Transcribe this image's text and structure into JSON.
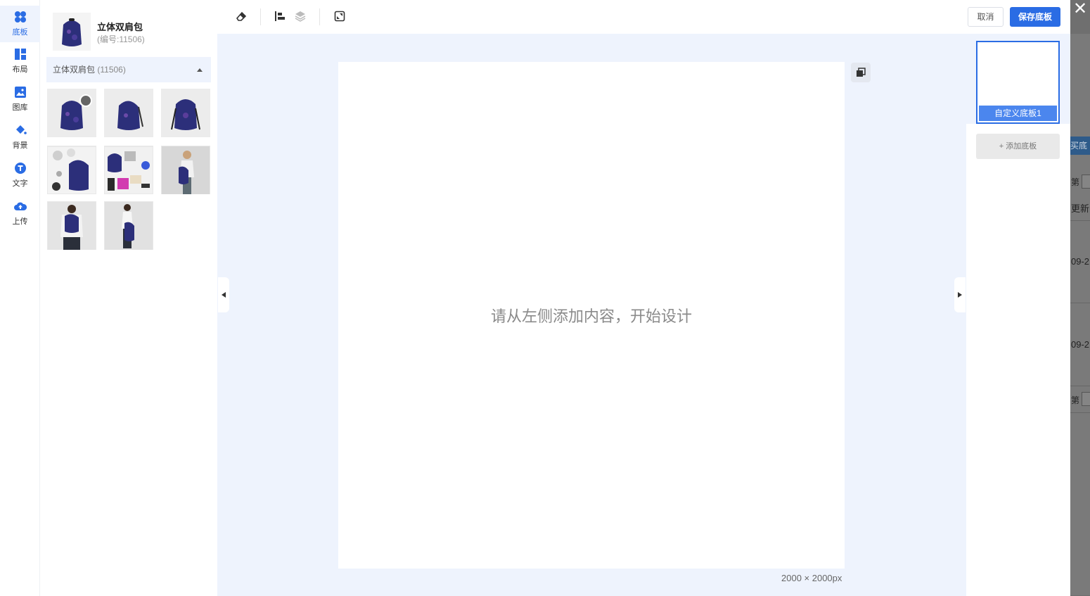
{
  "rail": {
    "items": [
      {
        "label": "底板",
        "icon": "clover-icon",
        "active": true
      },
      {
        "label": "布局",
        "icon": "layout-icon",
        "active": false
      },
      {
        "label": "图库",
        "icon": "image-icon",
        "active": false
      },
      {
        "label": "背景",
        "icon": "paint-bucket-icon",
        "active": false
      },
      {
        "label": "文字",
        "icon": "text-icon",
        "active": false
      },
      {
        "label": "上传",
        "icon": "cloud-upload-icon",
        "active": false
      }
    ]
  },
  "product": {
    "name": "立体双肩包",
    "code": "(编号:11506)",
    "dropdown_name": "立体双肩包",
    "dropdown_code": "(11506)"
  },
  "toolbar": {
    "cancel_label": "取消",
    "save_label": "保存底板"
  },
  "canvas": {
    "hint": "请从左侧添加内容，开始设计",
    "size": "2000 × 2000px"
  },
  "boards": {
    "items": [
      {
        "label": "自定义底板1",
        "selected": true
      }
    ],
    "add_label": "+ 添加底板"
  },
  "background_page": {
    "texts": [
      "买底",
      "第",
      "更新",
      "09-2",
      "09-2",
      "第"
    ]
  },
  "colors": {
    "accent": "#2a6ce4",
    "canvas_bg": "#eef3fd"
  }
}
